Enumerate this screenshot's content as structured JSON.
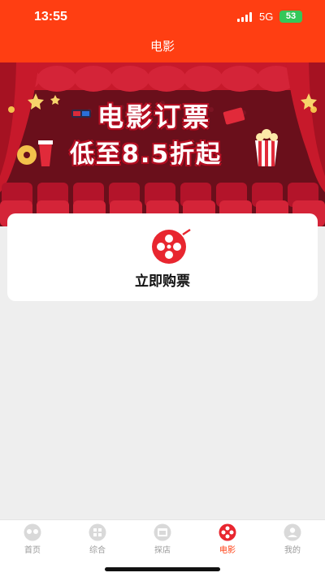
{
  "status_bar": {
    "time": "13:55",
    "network": "5G",
    "battery": "53"
  },
  "header": {
    "title": "电影"
  },
  "banner": {
    "line1": "电影订票",
    "line2": "低至8.5折起"
  },
  "card": {
    "button_label": "立即购票",
    "icon": "film-reel-icon"
  },
  "tabs": [
    {
      "label": "首页",
      "icon": "home-icon",
      "active": false
    },
    {
      "label": "综合",
      "icon": "grid-icon",
      "active": false
    },
    {
      "label": "探店",
      "icon": "store-icon",
      "active": false
    },
    {
      "label": "电影",
      "icon": "film-icon",
      "active": true
    },
    {
      "label": "我的",
      "icon": "user-icon",
      "active": false
    }
  ],
  "colors": {
    "brand": "#ff3e12",
    "active_tab": "#ff3e12",
    "inactive_tab": "#9a9a9a",
    "battery": "#34c759"
  }
}
